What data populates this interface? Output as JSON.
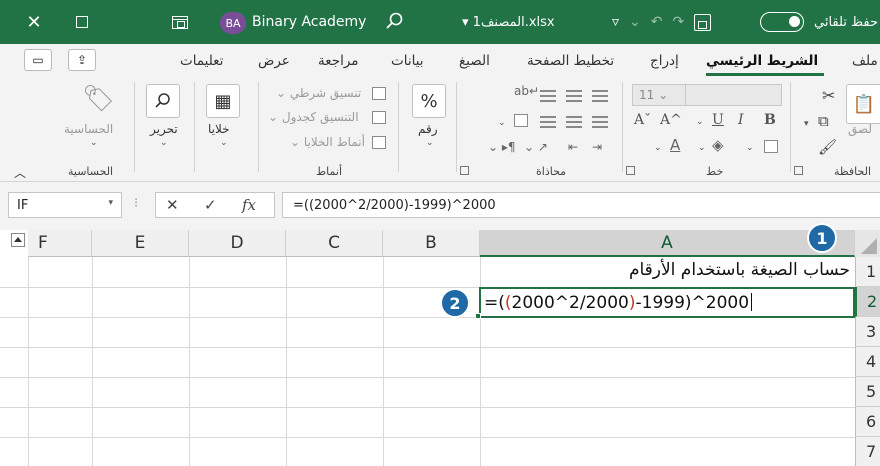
{
  "titlebar": {
    "avatar_initials": "BA",
    "account_name": "Binary Academy",
    "file_name": "المصنف1.xlsx",
    "file_name_caret": "▾",
    "autosave_label": "حفظ تلقائي",
    "autosave_on": true,
    "accent_color": "#217346"
  },
  "ribbon_tabs": [
    "ملف",
    "الشريط الرئيسي",
    "إدراج",
    "تخطيط الصفحة",
    "الصيغ",
    "بيانات",
    "مراجعة",
    "عرض",
    "تعليمات"
  ],
  "ribbon_active_tab": "الشريط الرئيسي",
  "ribbon": {
    "clipboard": {
      "group": "الحافظة",
      "paste": "لصق"
    },
    "font": {
      "group": "خط",
      "size": "11",
      "bold": "B",
      "italic": "I",
      "underline": "U",
      "grow": "A^",
      "shrink": "Aˇ"
    },
    "alignment": {
      "group": "محاذاة"
    },
    "number": {
      "group": "رقم",
      "symbol": "%"
    },
    "styles": {
      "group": "أنماط",
      "conditional": "تنسيق شرطي",
      "as_table": "التنسيق كجدول",
      "cell_styles": "أنماط الخلايا"
    },
    "cells": {
      "label": "خلايا"
    },
    "editing": {
      "label": "تحرير"
    },
    "sensitivity": {
      "label": "الحساسية",
      "group": "الحساسية"
    }
  },
  "formula_bar": {
    "name_box": "IF",
    "formula": "=((2000^2/2000)-1999)^2000"
  },
  "grid": {
    "columns": [
      "A",
      "B",
      "C",
      "D",
      "E",
      "F"
    ],
    "selected_column": "A",
    "rows": [
      "1",
      "2",
      "3",
      "4",
      "5",
      "6",
      "7"
    ],
    "selected_row": "2",
    "cell_a1": "حساب الصيغة باستخدام الأرقام",
    "cell_a2_parts": {
      "p1": "=(",
      "p2": "(",
      "p3": "2000^2/2000",
      "p4": ")",
      "p5": "-1999)^2000"
    }
  },
  "callouts": [
    "1",
    "2"
  ],
  "colors": {
    "callout": "#1f6aa6",
    "paren_red": "#c0392b",
    "paren_purple": "#7d3c98"
  }
}
